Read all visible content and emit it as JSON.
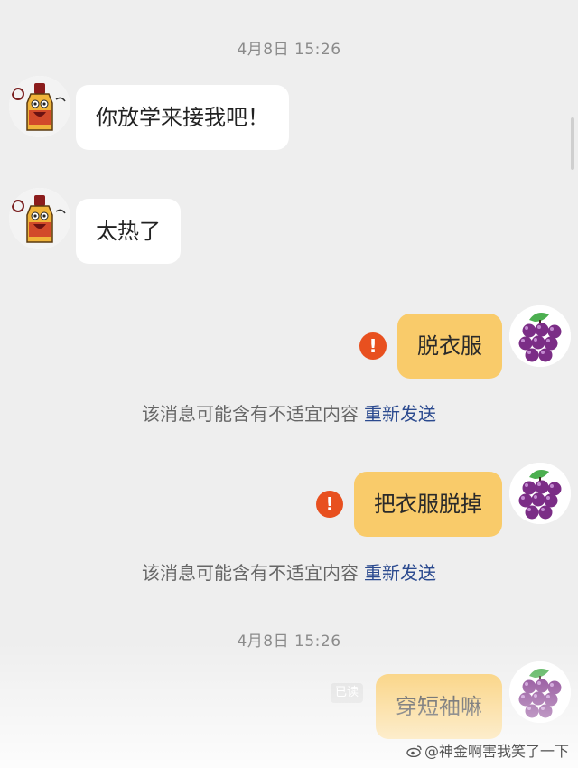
{
  "chat": {
    "timestamp_top": "4月8日 15:26",
    "timestamp_bottom": "4月8日 15:26",
    "messages": [
      {
        "sender": "other",
        "avatar": "cartoon-bottle-avatar",
        "text": "你放学来接我吧！"
      },
      {
        "sender": "other",
        "avatar": "cartoon-bottle-avatar",
        "text": "太热了"
      },
      {
        "sender": "self",
        "avatar": "grape-avatar",
        "text": "脱衣服",
        "status": "failed"
      },
      {
        "sender": "self",
        "avatar": "grape-avatar",
        "text": "把衣服脱掉",
        "status": "failed"
      },
      {
        "sender": "self",
        "avatar": "grape-avatar",
        "text": "穿短袖嘛",
        "status": "read"
      }
    ],
    "warning_symbol": "!",
    "blocked_notice": "该消息可能含有不适宜内容",
    "resend_label": "重新发送",
    "read_label": "已读"
  },
  "watermark": {
    "text": "@神金啊害我笑了一下",
    "icon": "weibo-icon"
  },
  "colors": {
    "background": "#eeeeee",
    "self_bubble": "#f9cb6a",
    "other_bubble": "#ffffff",
    "warning": "#e8501f",
    "resend_link": "#2b4a8f",
    "grape": "#7b2d86"
  }
}
